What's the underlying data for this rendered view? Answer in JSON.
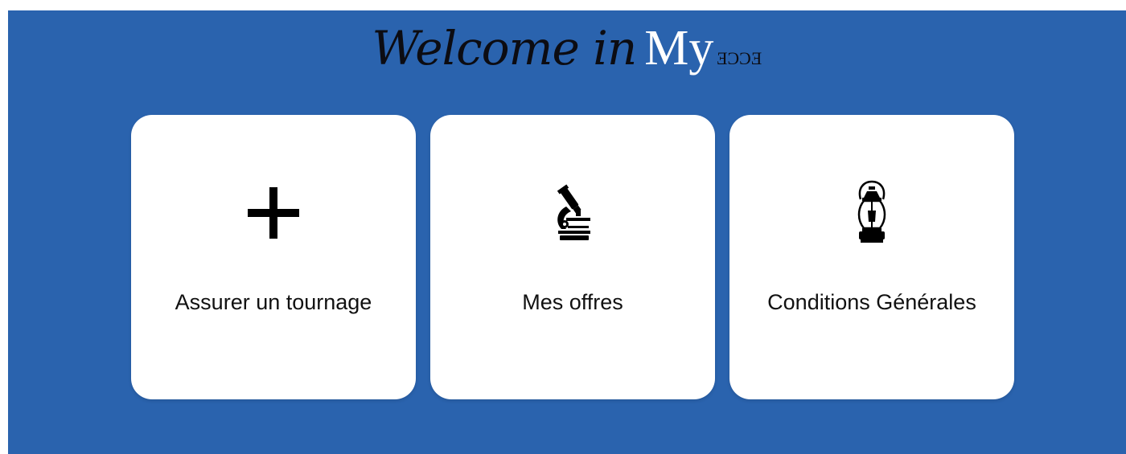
{
  "header": {
    "welcome_text": "Welcome in",
    "my_text": "My",
    "brand_text": "ECCE"
  },
  "cards": [
    {
      "label": "Assurer un tournage",
      "icon": "plus-icon"
    },
    {
      "label": "Mes offres",
      "icon": "microscope-icon"
    },
    {
      "label": "Conditions Générales",
      "icon": "lantern-icon"
    }
  ],
  "colors": {
    "background": "#2a63ae",
    "card": "#ffffff",
    "text": "#111111"
  }
}
